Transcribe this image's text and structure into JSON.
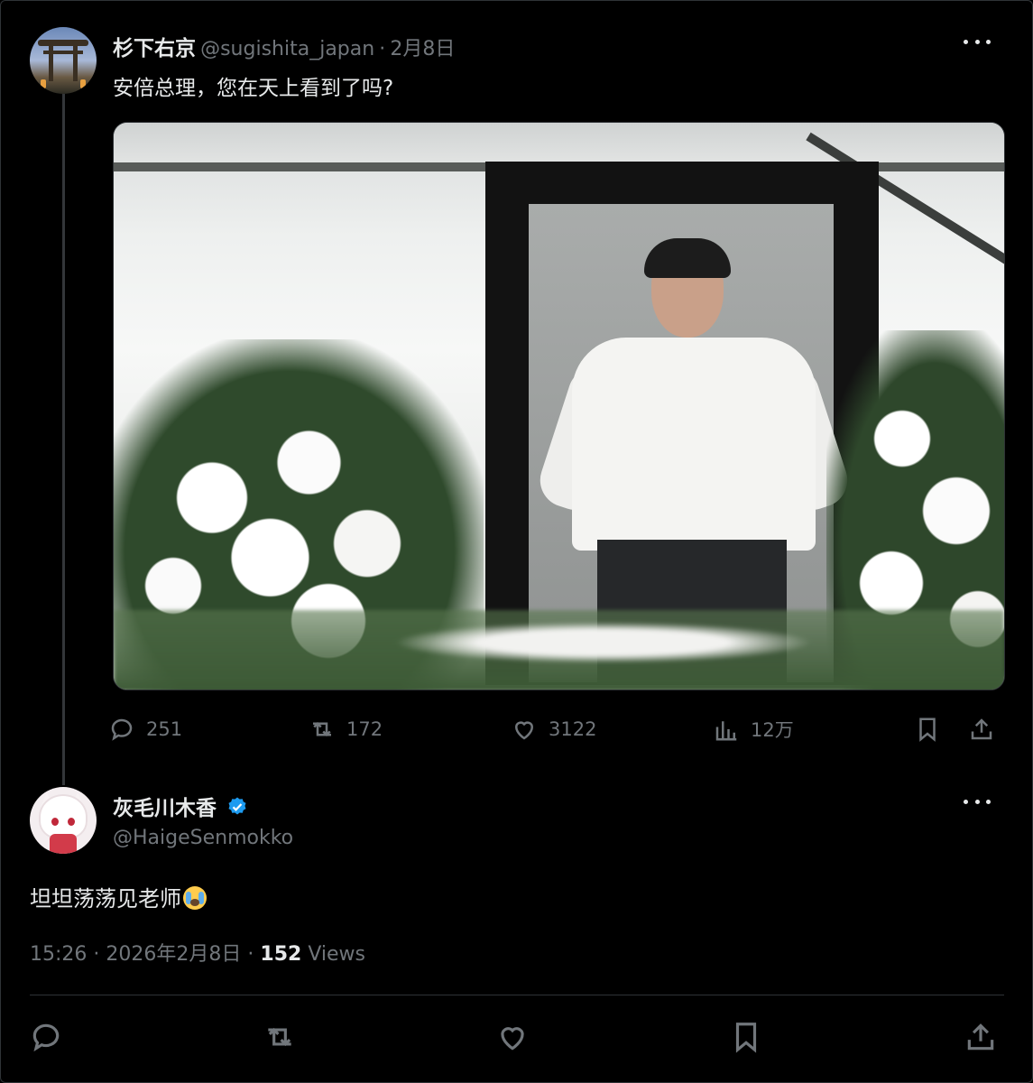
{
  "colors": {
    "background": "#000000",
    "text": "#e7e9ea",
    "muted": "#71767b",
    "verified": "#1d9bf0",
    "divider": "#2f3336"
  },
  "post": {
    "author_name": "杉下右京",
    "handle": "@sugishita_japan",
    "separator": "·",
    "date": "2月8日",
    "text": "安倍总理，您在天上看到了吗?",
    "image_alt_icon": "memorial-portrait-photo",
    "stats": {
      "replies": "251",
      "reposts": "172",
      "likes": "3122",
      "views": "12万"
    }
  },
  "reply": {
    "author_name": "灰毛川木香",
    "handle": "@HaigeSenmokko",
    "verified": true,
    "text": "坦坦荡荡见老师",
    "emoji": "crying-face-emoji",
    "time": "15:26",
    "separator": "·",
    "date": "2026年2月8日",
    "separator2": "·",
    "views_count": "152",
    "views_label": "Views"
  },
  "icons": {
    "more": "more-icon",
    "reply": "reply-icon",
    "repost": "repost-icon",
    "like": "heart-icon",
    "analytics": "analytics-icon",
    "bookmark": "bookmark-icon",
    "share": "share-icon"
  }
}
